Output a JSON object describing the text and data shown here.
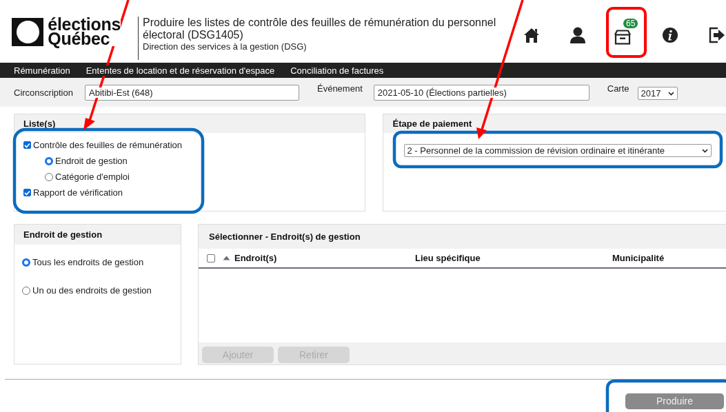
{
  "header": {
    "logo": [
      "élections",
      "Québec"
    ],
    "title": "Produire les listes de contrôle des feuilles de rémunération du personnel électoral (DSG1405)",
    "subtitle": "Direction des services à la gestion (DSG)",
    "icons": [
      {
        "kind": "home"
      },
      {
        "kind": "user"
      },
      {
        "kind": "archive",
        "badge": "65"
      },
      {
        "kind": "info"
      },
      {
        "kind": "exit"
      }
    ]
  },
  "nav": [
    "Rémunération",
    "Ententes de location et de réservation d'espace",
    "Conciliation de factures"
  ],
  "filters": {
    "circonscription": {
      "label": "Circonscription",
      "value": "Abitibi-Est (648)"
    },
    "evenement": {
      "label": "Événement",
      "value": "2021-05-10 (Élections partielles)"
    },
    "carte": {
      "label": "Carte",
      "value": "2017"
    }
  },
  "lists_panel": {
    "title": "Liste(s)",
    "items": [
      {
        "label": "Contrôle des feuilles de rémunération",
        "checked": true,
        "children": [
          {
            "label": "Endroit de gestion",
            "selected": true
          },
          {
            "label": "Catégorie d'emploi",
            "selected": false
          }
        ]
      },
      {
        "label": "Rapport de vérification",
        "checked": true
      }
    ]
  },
  "payment_panel": {
    "title": "Étape de paiement",
    "value": "2 - Personnel de la commission de révision ordinaire et itinérante"
  },
  "location_panel": {
    "title": "Endroit de gestion",
    "options": [
      {
        "label": "Tous les endroits de gestion",
        "selected": true
      },
      {
        "label": "Un ou des endroits de gestion",
        "selected": false
      }
    ]
  },
  "selection_panel": {
    "title": "Sélectionner - Endroit(s) de gestion",
    "select_all_checked": false,
    "columns": [
      {
        "label": "Endroit(s)",
        "sorted": true
      },
      {
        "label": "Lieu spécifique",
        "sorted": false
      },
      {
        "label": "Municipalité",
        "sorted": false
      }
    ],
    "buttons": [
      {
        "label": "Ajouter",
        "disabled": true
      },
      {
        "label": "Retirer",
        "disabled": true
      }
    ]
  },
  "produce_button": {
    "label": "Produire",
    "disabled": true
  }
}
